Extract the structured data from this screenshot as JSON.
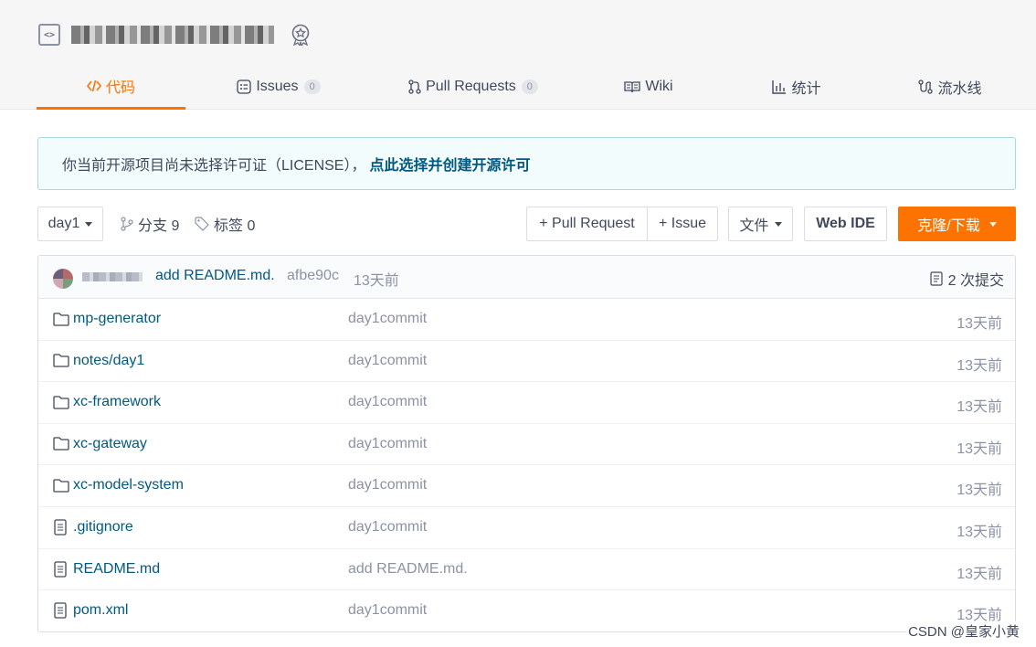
{
  "header": {
    "repo_name": "blurred-repo-name",
    "tabs": [
      {
        "label": "代码",
        "icon": "code-icon",
        "active": true
      },
      {
        "label": "Issues",
        "count": "0",
        "icon": "issues-icon"
      },
      {
        "label": "Pull Requests",
        "count": "0",
        "icon": "pull-request-icon"
      },
      {
        "label": "Wiki",
        "icon": "book-icon"
      },
      {
        "label": "统计",
        "icon": "chart-icon"
      },
      {
        "label": "流水线",
        "icon": "pipeline-icon"
      }
    ]
  },
  "notice": {
    "text": "你当前开源项目尚未选择许可证（LICENSE），",
    "link": "点此选择并创建开源许可"
  },
  "toolbar": {
    "branch": "day1",
    "branches": "分支 9",
    "tags": "标签 0",
    "pull_request": "+ Pull Request",
    "issue": "+ Issue",
    "file": "文件",
    "web_ide": "Web IDE",
    "clone": "克隆/下载"
  },
  "latest_commit": {
    "author": "blurred-author",
    "message": "add README.md.",
    "hash": "afbe90c",
    "time": "13天前",
    "count": "2 次提交"
  },
  "files": [
    {
      "name": "mp-generator",
      "type": "folder",
      "message": "day1commit",
      "time": "13天前"
    },
    {
      "name": "notes/day1",
      "type": "folder",
      "message": "day1commit",
      "time": "13天前"
    },
    {
      "name": "xc-framework",
      "type": "folder",
      "message": "day1commit",
      "time": "13天前"
    },
    {
      "name": "xc-gateway",
      "type": "folder",
      "message": "day1commit",
      "time": "13天前"
    },
    {
      "name": "xc-model-system",
      "type": "folder",
      "message": "day1commit",
      "time": "13天前"
    },
    {
      "name": ".gitignore",
      "type": "file",
      "message": "day1commit",
      "time": "13天前"
    },
    {
      "name": "README.md",
      "type": "file",
      "message": "add README.md.",
      "time": "13天前"
    },
    {
      "name": "pom.xml",
      "type": "file",
      "message": "day1commit",
      "time": "13天前"
    }
  ],
  "watermark": "CSDN @皇家小黄",
  "colors": {
    "accent": "#fe7300",
    "link": "#005980",
    "muted": "#8c92a4"
  }
}
